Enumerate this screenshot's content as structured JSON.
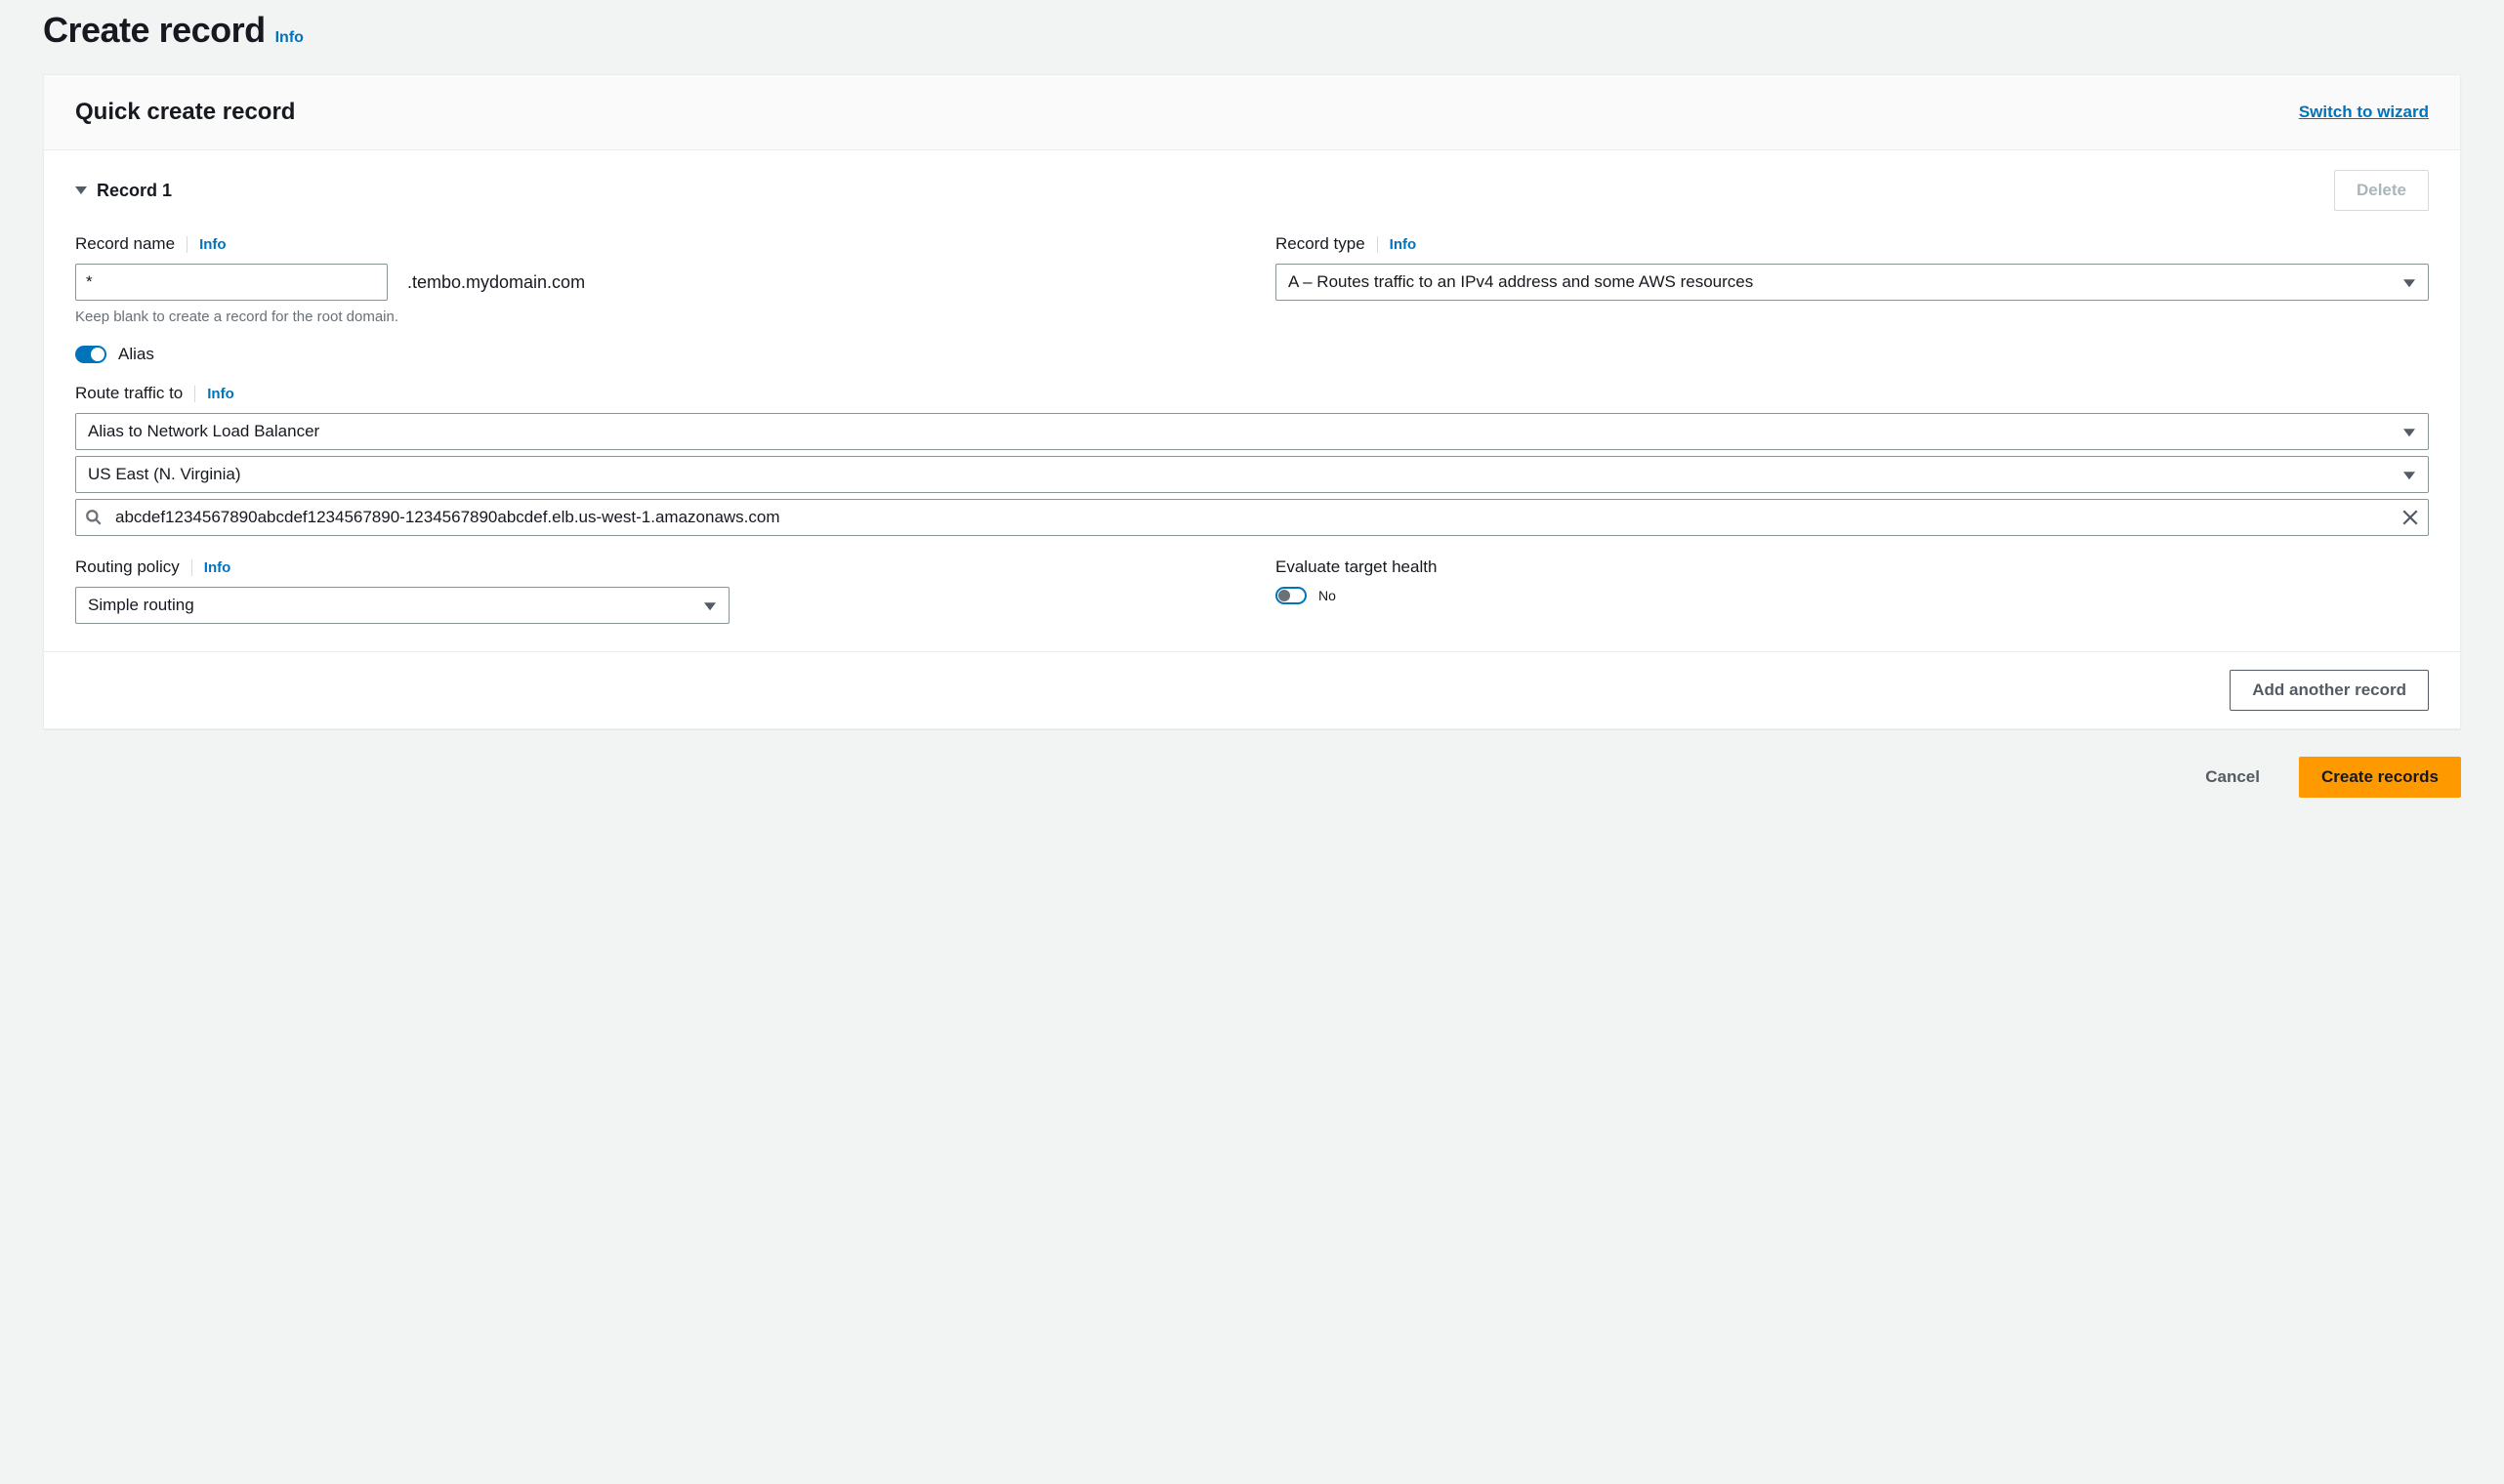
{
  "header": {
    "title": "Create record",
    "info_label": "Info"
  },
  "panel": {
    "title": "Quick create record",
    "switch_link": "Switch to wizard"
  },
  "record": {
    "heading": "Record 1",
    "delete_label": "Delete",
    "record_name": {
      "label": "Record name",
      "info": "Info",
      "value": "*",
      "suffix": ".tembo.mydomain.com",
      "hint": "Keep blank to create a record for the root domain."
    },
    "record_type": {
      "label": "Record type",
      "info": "Info",
      "value": "A – Routes traffic to an IPv4 address and some AWS resources"
    },
    "alias": {
      "label": "Alias",
      "on": true
    },
    "route_traffic": {
      "label": "Route traffic to",
      "info": "Info",
      "endpoint_type": "Alias to Network Load Balancer",
      "region": "US East (N. Virginia)",
      "load_balancer": "abcdef1234567890abcdef1234567890-1234567890abcdef.elb.us-west-1.amazonaws.com"
    },
    "routing_policy": {
      "label": "Routing policy",
      "info": "Info",
      "value": "Simple routing"
    },
    "evaluate_target_health": {
      "label": "Evaluate target health",
      "value_label": "No",
      "on": false
    }
  },
  "footer": {
    "add_another": "Add another record"
  },
  "actions": {
    "cancel": "Cancel",
    "create": "Create records"
  }
}
